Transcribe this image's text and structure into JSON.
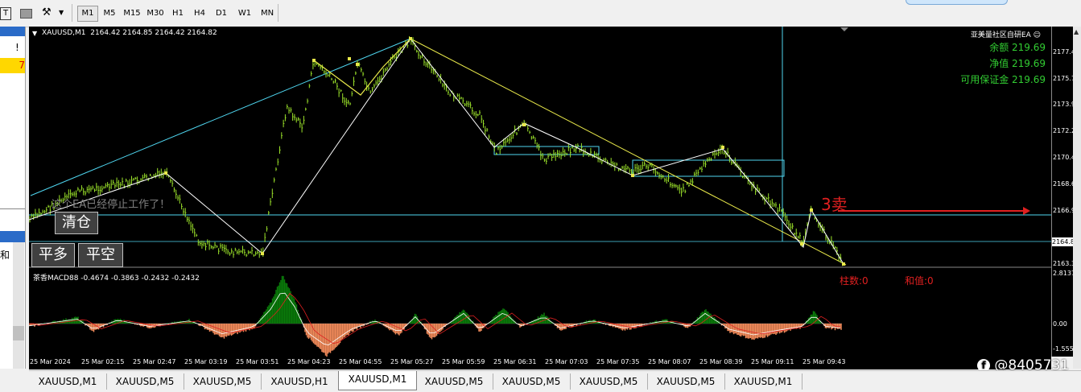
{
  "toolbar": {
    "timeframes": [
      "M1",
      "M5",
      "M15",
      "M30",
      "H1",
      "H4",
      "D1",
      "W1",
      "MN"
    ],
    "active_timeframe": "M1"
  },
  "left_panel": {
    "row1": "!",
    "row2": "7",
    "row3": "和"
  },
  "chart": {
    "title": "XAUUSD,M1  2164.42 2164.85 2164.42 2164.82",
    "ea_label": "亚美量社区自研EA",
    "balance": "余额 219.69",
    "equity": "净值 219.69",
    "free_margin": "可用保证金 219.69",
    "stopped_notice": "这个EA已经停止工作了！",
    "sell_label": "3卖",
    "bars_count": "柱数:0",
    "sum_value": "和值:0",
    "macd_label": "茶香MACD88 -0.4674 -0.3863 -0.2432 -0.2432",
    "current_price": "2164.82",
    "watermark": "@8405731"
  },
  "buttons": {
    "close_all": "清仓",
    "close_long": "平多",
    "close_short": "平空"
  },
  "price_ticks": [
    "2177.45",
    "2175.70",
    "2173.95",
    "2172.20",
    "2170.40",
    "2168.65",
    "2166.90",
    "2165.15",
    "2163.35"
  ],
  "macd_ticks": [
    "2.8137",
    "0.00",
    "-1.5557"
  ],
  "time_ticks": [
    "25 Mar 2024",
    "25 Mar 02:15",
    "25 Mar 02:47",
    "25 Mar 03:19",
    "25 Mar 03:51",
    "25 Mar 04:23",
    "25 Mar 04:55",
    "25 Mar 05:27",
    "25 Mar 05:59",
    "25 Mar 06:31",
    "25 Mar 07:03",
    "25 Mar 07:35",
    "25 Mar 08:07",
    "25 Mar 08:39",
    "25 Mar 09:11",
    "25 Mar 09:43"
  ],
  "tabs": [
    "XAUUSD,M1",
    "XAUUSD,M5",
    "XAUUSD,M5",
    "XAUUSD,H1",
    "XAUUSD,M1",
    "XAUUSD,M5",
    "XAUUSD,M5",
    "XAUUSD,M5",
    "XAUUSD,M5",
    "XAUUSD,M1"
  ],
  "active_tab_index": 4,
  "colors": {
    "bars": "#9be22a",
    "zigzag_white": "#ffffff",
    "trend_cyan": "#4fd6f0",
    "trend_yellow": "#e8e84a",
    "macd_up": "#0a7a0a",
    "macd_down": "#f08a5a",
    "sell_arrow": "#e02020",
    "account_text": "#32cd32"
  }
}
